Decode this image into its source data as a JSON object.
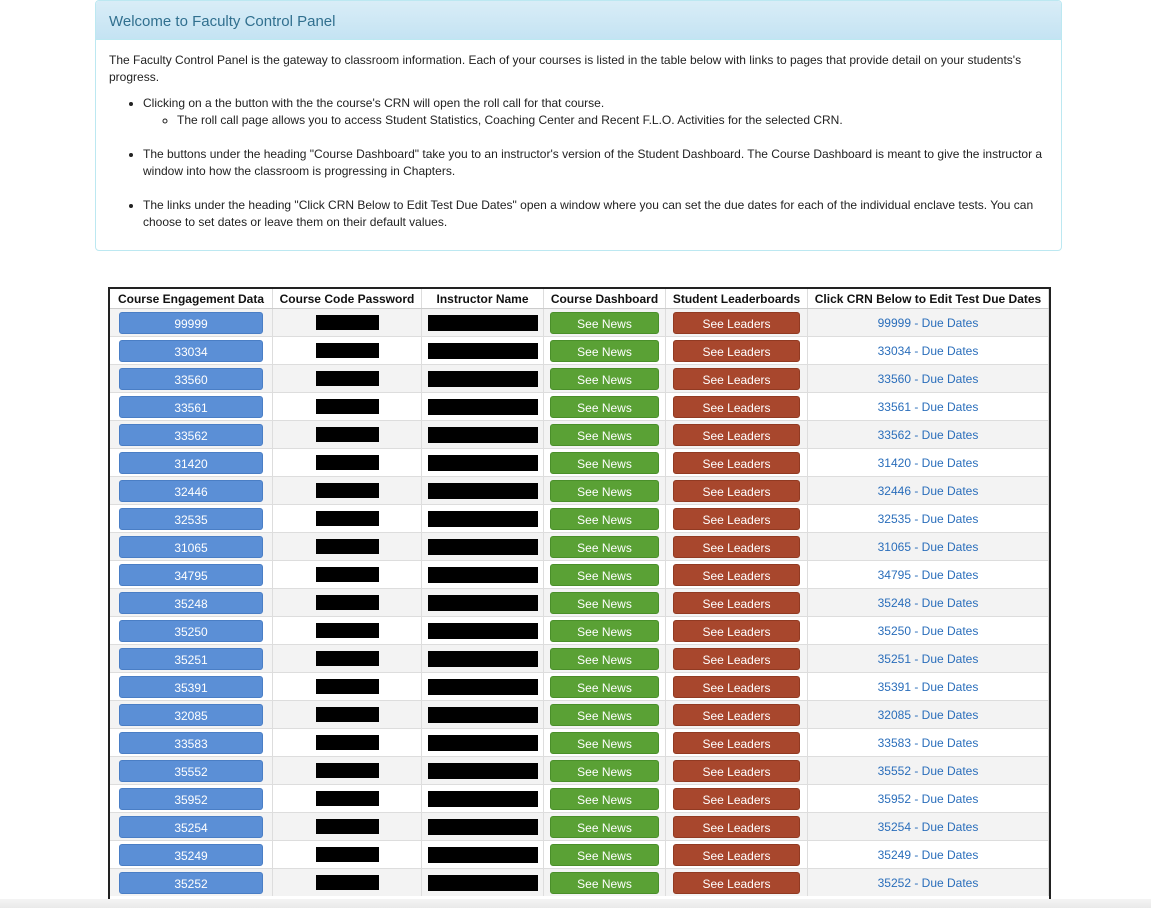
{
  "panel": {
    "title": "Welcome to Faculty Control Panel",
    "intro": "The Faculty Control Panel is the gateway to classroom information. Each of your courses is listed in the table below with links to pages that provide detail on your students's progress.",
    "bullet1": "Clicking on a the button with the the course's CRN will open the roll call for that course.",
    "bullet1_sub": "The roll call page allows you to access Student Statistics, Coaching Center and Recent F.L.O. Activities for the selected CRN.",
    "bullet2": "The buttons under the heading \"Course Dashboard\" take you to an instructor's version of the Student Dashboard. The Course Dashboard is meant to give the instructor a window into how the classroom is progressing in Chapters.",
    "bullet3": "The links under the heading \"Click CRN Below to Edit Test Due Dates\" open a window where you can set the due dates for each of the individual enclave tests. You can choose to set dates or leave them on their default values."
  },
  "table": {
    "headers": [
      "Course Engagement Data",
      "Course Code Password",
      "Instructor Name",
      "Course Dashboard",
      "Student Leaderboards",
      "Click CRN Below to Edit Test Due Dates"
    ],
    "news_label": "See News",
    "leaders_label": "See Leaders",
    "rows": [
      {
        "crn": "99999",
        "due": "99999 - Due Dates"
      },
      {
        "crn": "33034",
        "due": "33034 - Due Dates"
      },
      {
        "crn": "33560",
        "due": "33560 - Due Dates"
      },
      {
        "crn": "33561",
        "due": "33561 - Due Dates"
      },
      {
        "crn": "33562",
        "due": "33562 - Due Dates"
      },
      {
        "crn": "31420",
        "due": "31420 - Due Dates"
      },
      {
        "crn": "32446",
        "due": "32446 - Due Dates"
      },
      {
        "crn": "32535",
        "due": "32535 - Due Dates"
      },
      {
        "crn": "31065",
        "due": "31065 - Due Dates"
      },
      {
        "crn": "34795",
        "due": "34795 - Due Dates"
      },
      {
        "crn": "35248",
        "due": "35248 - Due Dates"
      },
      {
        "crn": "35250",
        "due": "35250 - Due Dates"
      },
      {
        "crn": "35251",
        "due": "35251 - Due Dates"
      },
      {
        "crn": "35391",
        "due": "35391 - Due Dates"
      },
      {
        "crn": "32085",
        "due": "32085 - Due Dates"
      },
      {
        "crn": "33583",
        "due": "33583 - Due Dates"
      },
      {
        "crn": "35552",
        "due": "35552 - Due Dates"
      },
      {
        "crn": "35952",
        "due": "35952 - Due Dates"
      },
      {
        "crn": "35254",
        "due": "35254 - Due Dates"
      },
      {
        "crn": "35249",
        "due": "35249 - Due Dates"
      },
      {
        "crn": "35252",
        "due": "35252 - Due Dates"
      }
    ]
  },
  "colors": {
    "crn_button": "#5b8fd6",
    "news_button": "#5aa135",
    "leaders_button": "#a8472d",
    "link": "#2a6ebb",
    "panel_heading": "#31708f"
  }
}
